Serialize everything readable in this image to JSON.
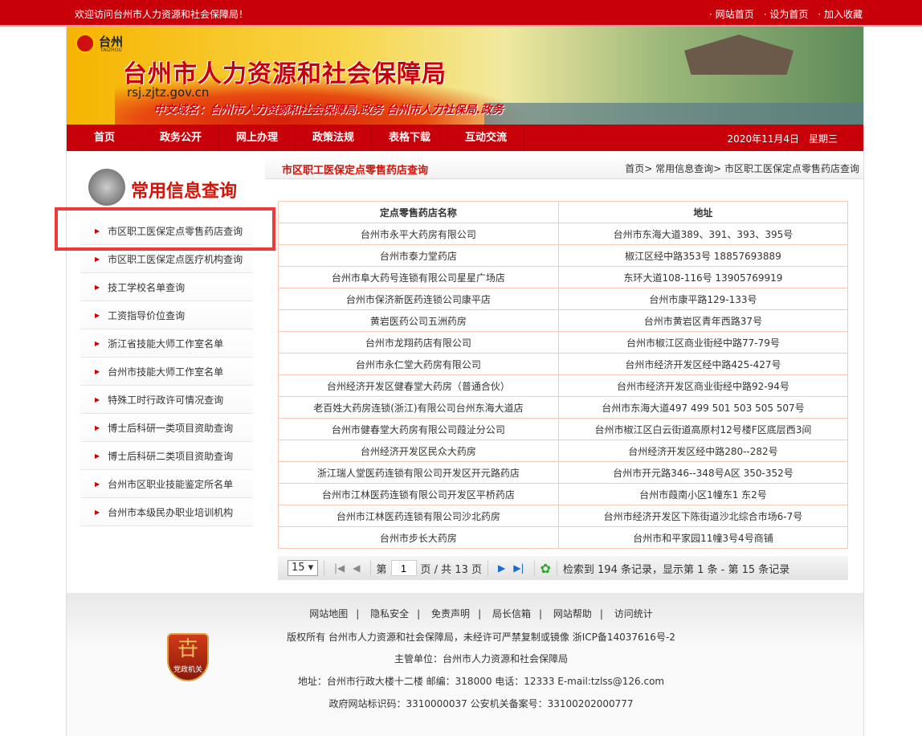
{
  "topbar": {
    "welcome": "欢迎访问台州市人力资源和社会保障局！",
    "links": [
      "· 网站首页",
      "· 设为首页",
      "· 加入收藏"
    ]
  },
  "banner": {
    "logo_text": "台州",
    "logo_sub": "TAIZHOU",
    "title": "台州市人力资源和社会保障局",
    "domain": "rsj.zjtz.gov.cn",
    "cn_domain": "中文域名：台州市人力资源和社会保障局.政务   台州市人力社保局.政务"
  },
  "nav": {
    "items": [
      "首页",
      "政务公开",
      "网上办理",
      "政策法规",
      "表格下载",
      "互动交流"
    ],
    "date": "2020年11月4日　星期三"
  },
  "sidebar": {
    "title": "常用信息查询",
    "items": [
      "市区职工医保定点零售药店查询",
      "市区职工医保定点医疗机构查询",
      "技工学校名单查询",
      "工资指导价位查询",
      "浙江省技能大师工作室名单",
      "台州市技能大师工作室名单",
      "特殊工时行政许可情况查询",
      "博士后科研一类项目资助查询",
      "博士后科研二类项目资助查询",
      "台州市区职业技能鉴定所名单",
      "台州市本级民办职业培训机构"
    ]
  },
  "content": {
    "title": "市区职工医保定点零售药店查询",
    "breadcrumb": [
      "首页>",
      "常用信息查询>",
      "市区职工医保定点零售药店查询"
    ],
    "table": {
      "headers": [
        "定点零售药店名称",
        "地址"
      ],
      "rows": [
        [
          "台州市永平大药房有限公司",
          "台州市东海大道389、391、393、395号"
        ],
        [
          "台州市泰力堂药店",
          "椒江区经中路353号 18857693889"
        ],
        [
          "台州市阜大药号连锁有限公司星星广场店",
          "东环大道108-116号 13905769919"
        ],
        [
          "台州市保济新医药连锁公司康平店",
          "台州市康平路129-133号"
        ],
        [
          "黄岩医药公司五洲药房",
          "台州市黄岩区青年西路37号"
        ],
        [
          "台州市龙翔药店有限公司",
          "台州市椒江区商业街经中路77-79号"
        ],
        [
          "台州市永仁堂大药房有限公司",
          "台州市经济开发区经中路425-427号"
        ],
        [
          "台州经济开发区健春堂大药房（普通合伙）",
          "台州市经济开发区商业街经中路92-94号"
        ],
        [
          "老百姓大药房连锁(浙江)有限公司台州东海大道店",
          "台州市东海大道497 499 501 503 505 507号"
        ],
        [
          "台州市健春堂大药房有限公司葭沚分公司",
          "台州市椒江区白云街道高原村12号楼F区底层西3间"
        ],
        [
          "台州经济开发区民众大药房",
          "台州经济开发区经中路280--282号"
        ],
        [
          "浙江瑞人堂医药连锁有限公司开发区开元路药店",
          "台州市开元路346--348号A区 350-352号"
        ],
        [
          "台州市江林医药连锁有限公司开发区平桥药店",
          "台州市葭南小区1幢东1 东2号"
        ],
        [
          "台州市江林医药连锁有限公司沙北药房",
          "台州市经济开发区下陈街道沙北综合市场6-7号"
        ],
        [
          "台州市步长大药房",
          "台州市和平家园11幢3号4号商铺"
        ]
      ]
    },
    "pager": {
      "page_size": "15 ▾",
      "page_label": "第",
      "page": "1",
      "total_pages": "页 / 共 13 页",
      "summary": "检索到 194 条记录，显示第 1 条 - 第 15 条记录"
    }
  },
  "footer": {
    "links": [
      "网站地图",
      "隐私安全",
      "免责声明",
      "局长信箱",
      "网站帮助",
      "访问统计"
    ],
    "copyright": "版权所有 台州市人力资源和社会保障局，未经许可严禁复制或镜像 浙ICP备14037616号-2",
    "sponsor": "主管单位：台州市人力资源和社会保障局",
    "address": "地址：台州市行政大楼十二楼 邮编：318000 电话：12333 E-mail:tzlss@126.com",
    "ids": "政府网站标识码：3310000037 公安机关备案号：33100202000777",
    "badge": "党政机关"
  }
}
